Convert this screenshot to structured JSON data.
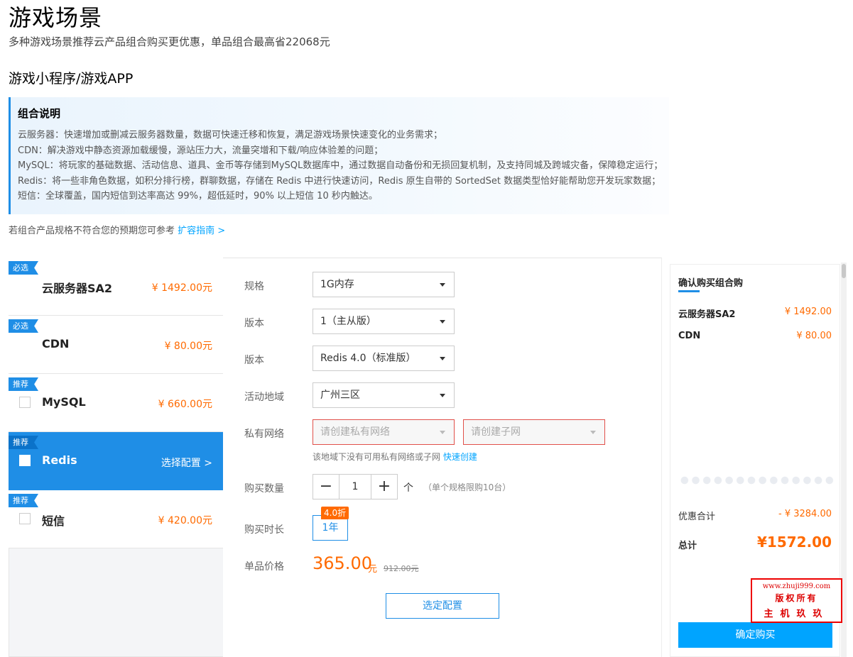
{
  "header": {
    "title": "游戏场景",
    "subtitle": "多种游戏场景推荐云产品组合购买更优惠，单品组合最高省22068元",
    "section": "游戏小程序/游戏APP"
  },
  "description": {
    "title": "组合说明",
    "lines": [
      "云服务器：快速增加或删减云服务器数量，数据可快速迁移和恢复，满足游戏场景快速变化的业务需求；",
      "CDN：解决游戏中静态资源加载缓慢，源站压力大，流量突增和下载/响应体验差的问题；",
      "MySQL：将玩家的基础数据、活动信息、道具、金币等存储到MySQL数据库中，通过数据自动备份和无损回复机制，及支持同城及跨城灾备，保障稳定运行；",
      "Redis：将一些非角色数据，如积分排行榜，群聊数据，存储在 Redis 中进行快速访问，Redis 原生自带的 SortedSet 数据类型恰好能帮助您开发玩家数据；",
      "短信：全球覆盖，国内短信到达率高达 99%，超低延时，90% 以上短信 10 秒内触达。"
    ]
  },
  "hint": {
    "text": "若组合产品规格不符合您的预期您可参考",
    "link": "扩容指南 >"
  },
  "products": [
    {
      "tag": "必选",
      "name": "云服务器SA2",
      "price": "¥ 1492.00元"
    },
    {
      "tag": "必选",
      "name": "CDN",
      "price": "¥ 80.00元"
    },
    {
      "tag": "推荐",
      "name": "MySQL",
      "price": "¥ 660.00元"
    },
    {
      "tag": "推荐",
      "name": "Redis",
      "action": "选择配置 >"
    },
    {
      "tag": "推荐",
      "name": "短信",
      "price": "¥ 420.00元"
    }
  ],
  "config": {
    "spec_label": "规格",
    "spec_value": "1G内存",
    "version_label": "版本",
    "version_value": "1（主从版）",
    "version2_label": "版本",
    "version2_value": "Redis 4.0（标准版）",
    "region_label": "活动地域",
    "region_value": "广州三区",
    "vpc_label": "私有网络",
    "vpc_placeholder": "请创建私有网络",
    "subnet_placeholder": "请创建子网",
    "vpc_hint": "该地域下没有可用私有网络或子网",
    "vpc_create": "快速创建",
    "qty_label": "购买数量",
    "qty_minus": "−",
    "qty_value": "1",
    "qty_plus": "+",
    "qty_unit": "个",
    "qty_limit": "（单个规格限购10台）",
    "duration_label": "购买时长",
    "duration_value": "1年",
    "discount": "4.0折",
    "price_label": "单品价格",
    "price": "365.00",
    "price_unit": "元",
    "price_original": "912.00元",
    "confirm": "选定配置"
  },
  "summary": {
    "title": "确认购买组合购",
    "items": [
      {
        "name": "云服务器SA2",
        "price": "¥ 1492.00"
      },
      {
        "name": "CDN",
        "price": "¥ 80.00"
      }
    ],
    "discount_label": "优惠合计",
    "discount_value": "- ¥ 3284.00",
    "total_label": "总计",
    "total_value": "¥1572.00",
    "buy": "确定购买"
  },
  "watermark": {
    "url": "www.zhuji999.com",
    "line2": "版权所有",
    "line3": "主机玖玖"
  },
  "colors": {
    "accent": "#1f8ee6",
    "price": "#ff6a00",
    "buy": "#00a4ff",
    "error": "#e1504a"
  }
}
